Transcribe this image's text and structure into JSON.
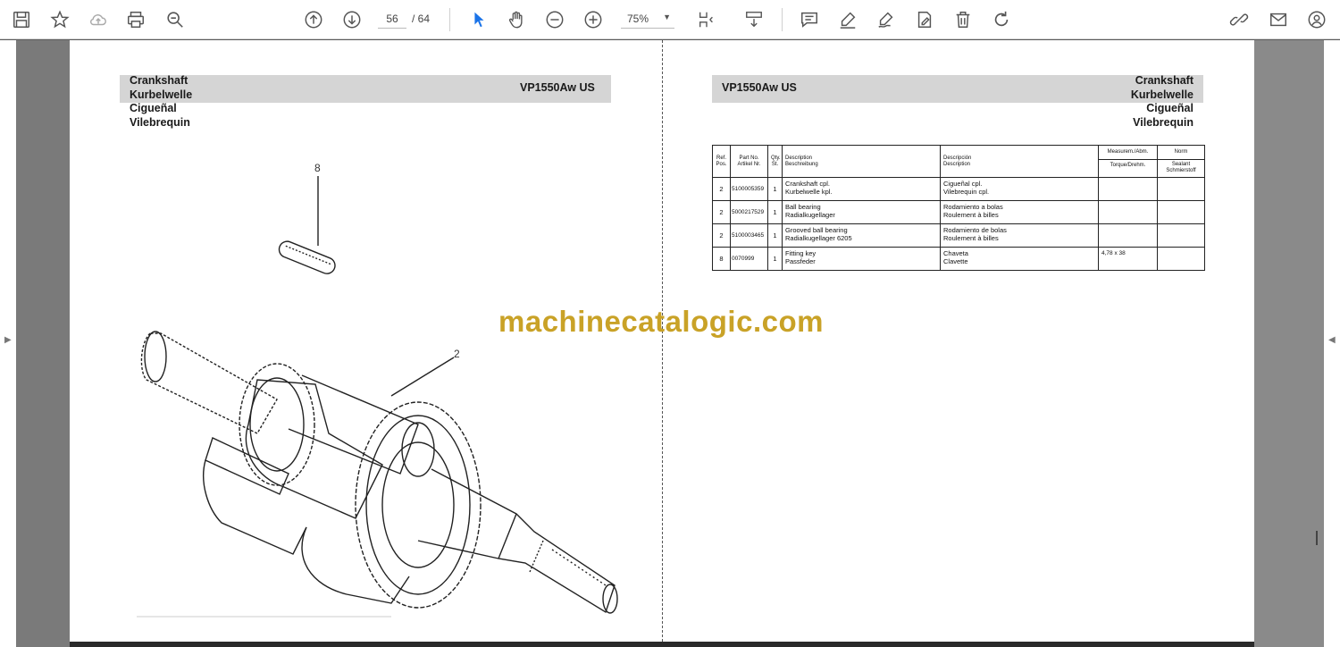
{
  "toolbar": {
    "page_current": "56",
    "page_total": "/ 64",
    "zoom": "75%"
  },
  "left_page": {
    "title_lines": [
      "Crankshaft",
      "Kurbelwelle",
      "Cigueñal",
      "Vilebrequin"
    ],
    "model": "VP1550Aw US",
    "callouts": [
      "8",
      "2"
    ]
  },
  "right_page": {
    "model": "VP1550Aw US",
    "title_lines": [
      "Crankshaft",
      "Kurbelwelle",
      "Cigueñal",
      "Vilebrequin"
    ],
    "table": {
      "headers": {
        "ref": [
          "Ref.",
          "Pos."
        ],
        "part": [
          "Part No.",
          "Artikel Nr."
        ],
        "qty": [
          "Qty.",
          "St."
        ],
        "desc_en": [
          "Description",
          "Beschreibung"
        ],
        "desc_es": [
          "Descripción",
          "Description"
        ],
        "measure": [
          "Measurem./Abm.",
          "Torque/Drehm."
        ],
        "norm": [
          "Norm",
          "Sealant",
          "Schmierstoff"
        ]
      },
      "rows": [
        {
          "ref": "2",
          "part": "5100005359",
          "qty": "1",
          "desc_en": [
            "Crankshaft cpl.",
            "Kurbelwelle kpl."
          ],
          "desc_es": [
            "Cigueñal cpl.",
            "Vilebrequin cpl."
          ],
          "measure": "",
          "norm": ""
        },
        {
          "ref": "2",
          "part": "5000217529",
          "qty": "1",
          "desc_en": [
            "Ball bearing",
            "Radialkugellager"
          ],
          "desc_es": [
            "Rodamiento a bolas",
            "Roulement à billes"
          ],
          "measure": "",
          "norm": ""
        },
        {
          "ref": "2",
          "part": "5100003465",
          "qty": "1",
          "desc_en": [
            "Grooved ball bearing",
            "Radialkugellager 6205"
          ],
          "desc_es": [
            "Rodamiento de bolas",
            "Roulement à billes"
          ],
          "measure": "",
          "norm": ""
        },
        {
          "ref": "8",
          "part": "0070999",
          "qty": "1",
          "desc_en": [
            "Fitting key",
            "Passfeder"
          ],
          "desc_es": [
            "Chaveta",
            "Clavette"
          ],
          "measure": "4,78 x 38",
          "norm": ""
        }
      ]
    }
  },
  "watermark": "machinecatalogic.com"
}
